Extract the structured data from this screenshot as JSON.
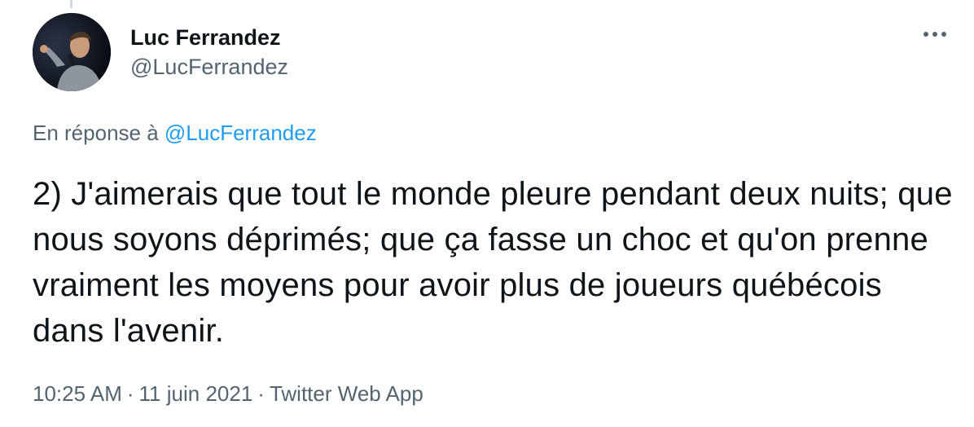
{
  "author": {
    "display_name": "Luc Ferrandez",
    "handle": "@LucFerrandez",
    "avatar": "speaker-with-microphone-photo"
  },
  "reply": {
    "prefix": "En réponse à",
    "mention": "@LucFerrandez"
  },
  "tweet": {
    "text": "2) J'aimerais que tout le monde pleure pendant deux nuits; que nous soyons déprimés; que ça fasse un choc et qu'on prenne vraiment les moyens pour avoir plus de joueurs québécois dans l'avenir."
  },
  "meta": {
    "time": "10:25 AM",
    "separator": "·",
    "date": "11 juin 2021",
    "source": "Twitter Web App"
  },
  "icons": {
    "more": "more-horizontal-icon"
  },
  "colors": {
    "text_primary": "#0f1419",
    "text_secondary": "#536471",
    "link": "#1d9bf0"
  }
}
